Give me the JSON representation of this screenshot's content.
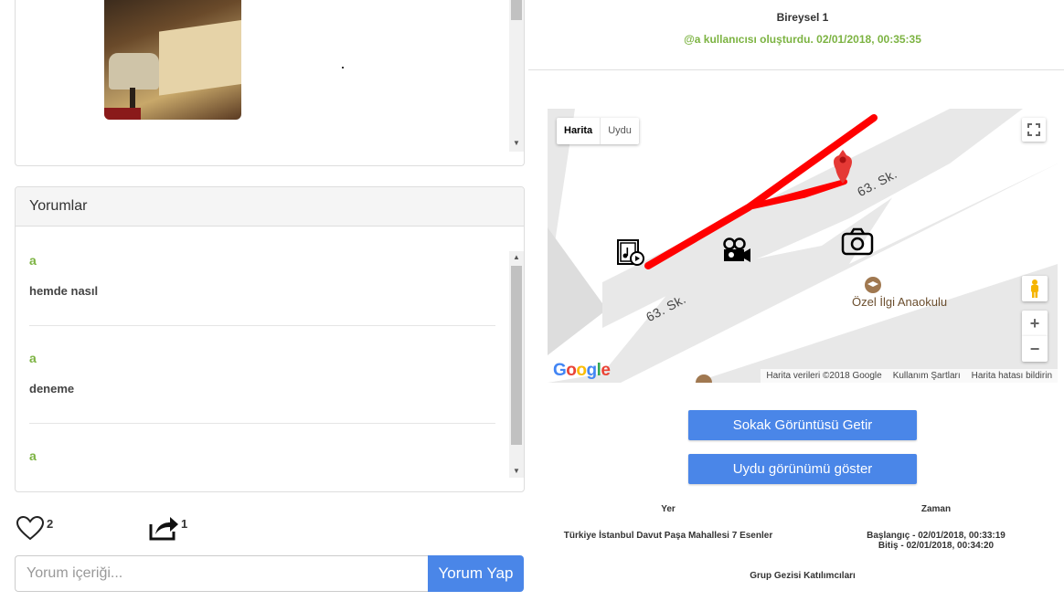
{
  "comments_panel": {
    "title": "Yorumlar",
    "comments": [
      {
        "author": "a",
        "text": "hemde nasıl"
      },
      {
        "author": "a",
        "text": "deneme"
      },
      {
        "author": "a",
        "text": ""
      }
    ]
  },
  "actions": {
    "like_count": "2",
    "share_count": "1"
  },
  "comment_form": {
    "placeholder": "Yorum içeriği...",
    "submit_label": "Yorum Yap"
  },
  "post": {
    "title": "Bireysel 1",
    "creator_line": "@a kullanıcısı oluşturdu. 02/01/2018, 00:35:35"
  },
  "map": {
    "type_map": "Harita",
    "type_satellite": "Uydu",
    "street_label_1": "63. Sk.",
    "street_label_2": "63. Sk.",
    "poi_label": "Özel İlgi Anaokulu",
    "logo": "Google",
    "attribution": [
      "Harita verileri ©2018 Google",
      "Kullanım Şartları",
      "Harita hatası bildirin"
    ],
    "zoom_in": "+",
    "zoom_out": "−",
    "route_color": "#ff0000",
    "marker_color": "#e53935"
  },
  "buttons": {
    "street_view": "Sokak Görüntüsü Getir",
    "satellite_view": "Uydu görünümü göster"
  },
  "details": {
    "place_header": "Yer",
    "place_value": "Türkiye İstanbul Davut Paşa Mahallesi 7 Esenler",
    "time_header": "Zaman",
    "start": "Başlangıç - 02/01/2018, 00:33:19",
    "end": "Bitiş - 02/01/2018, 00:34:20",
    "participants_header": "Grup Gezisi Katılımcıları"
  },
  "colors": {
    "accent_green": "#7cb342",
    "button_blue": "#4a86e8"
  }
}
